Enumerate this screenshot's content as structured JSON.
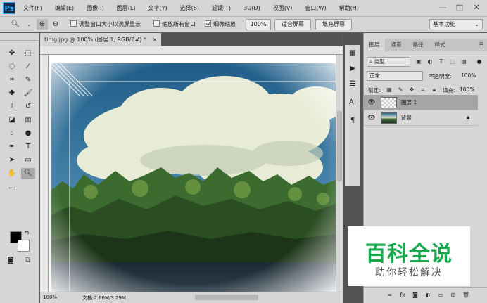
{
  "app": {
    "logo": "Ps"
  },
  "menu": [
    "文件(F)",
    "编辑(E)",
    "图像(I)",
    "图层(L)",
    "文字(Y)",
    "选择(S)",
    "滤镜(T)",
    "3D(D)",
    "视图(V)",
    "窗口(W)",
    "帮助(H)"
  ],
  "window_controls": {
    "minimize": "—",
    "maximize": "□",
    "close": "✕"
  },
  "options": {
    "resize_window_label": "调整窗口大小以满屏显示",
    "zoom_all_label": "缩放所有窗口",
    "scrubby_zoom_label": "细微缩放",
    "zoom_100": "100%",
    "fit_screen": "适合屏幕",
    "fill_screen": "填充屏幕",
    "workspace": "基本功能"
  },
  "document": {
    "tab_title": "timg.jpg @ 100% (图层 1, RGB/8#) *",
    "close": "×",
    "zoom": "100%",
    "doc_size": "文档:2.66M/3.29M"
  },
  "panel": {
    "tabs": [
      "图层",
      "通道",
      "路径",
      "样式"
    ],
    "filter_kind": "类型",
    "blend_mode": "正常",
    "opacity_label": "不透明度:",
    "opacity_value": "100%",
    "lock_label": "锁定:",
    "fill_label": "填充:",
    "fill_value": "100%",
    "layers": [
      {
        "name": "图层 1",
        "selected": true
      },
      {
        "name": "背景",
        "selected": false,
        "locked": true
      }
    ]
  },
  "watermark": {
    "title": "百科全说",
    "subtitle": "助你轻松解决"
  },
  "colors": {
    "accent": "#31a8ff",
    "watermark_green": "#1aa84f",
    "foreground": "#000000",
    "background": "#ffffff"
  }
}
